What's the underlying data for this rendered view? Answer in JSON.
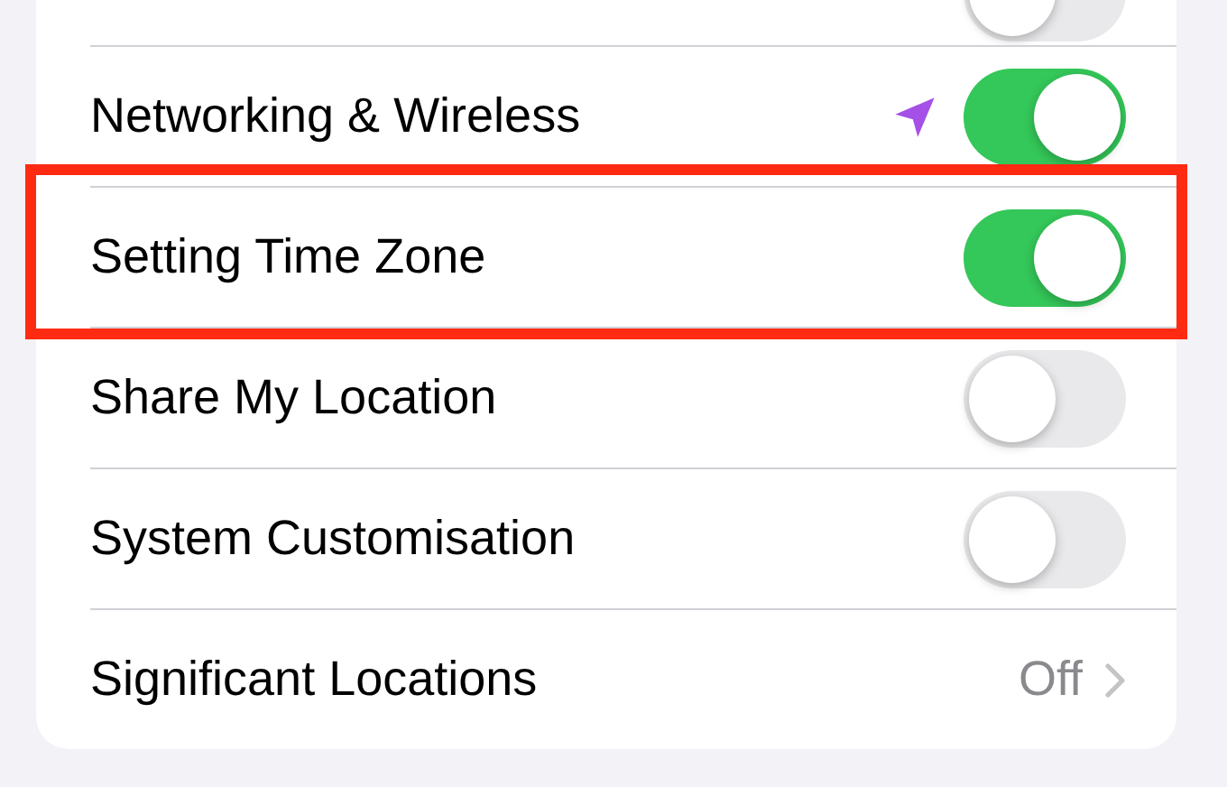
{
  "rows": [
    {
      "kind": "toggle",
      "on": false,
      "highlighted": false
    },
    {
      "kind": "toggle",
      "label": "Networking & Wireless",
      "on": true,
      "location_icon": true,
      "highlighted": false
    },
    {
      "kind": "toggle",
      "label": "Setting Time Zone",
      "on": true,
      "location_icon": false,
      "highlighted": true
    },
    {
      "kind": "toggle",
      "label": "Share My Location",
      "on": false,
      "location_icon": false,
      "highlighted": false
    },
    {
      "kind": "toggle",
      "label": "System Customisation",
      "on": false,
      "location_icon": false,
      "highlighted": false
    },
    {
      "kind": "link",
      "label": "Significant Locations",
      "value": "Off",
      "highlighted": false
    }
  ]
}
